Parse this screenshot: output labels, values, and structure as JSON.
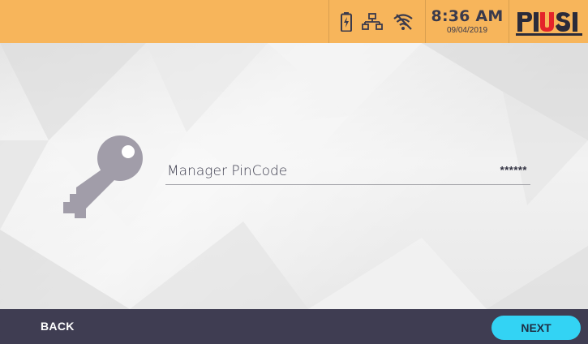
{
  "header": {
    "status_icons": [
      "battery-icon",
      "network-icon",
      "wifi-off-icon"
    ],
    "time": "8:36 AM",
    "date": "09/04/2019",
    "logo_text": "PIUSI",
    "colors": {
      "bar": "#f7b55b",
      "logo_red": "#e4242a",
      "logo_dark": "#2b2b3a"
    }
  },
  "form": {
    "icon": "key-icon",
    "pin_label": "Manager PinCode",
    "pin_value": "******"
  },
  "footer": {
    "back_label": "BACK",
    "next_label": "NEXT",
    "colors": {
      "bar": "#3f3d52",
      "next": "#33d3f4"
    }
  }
}
